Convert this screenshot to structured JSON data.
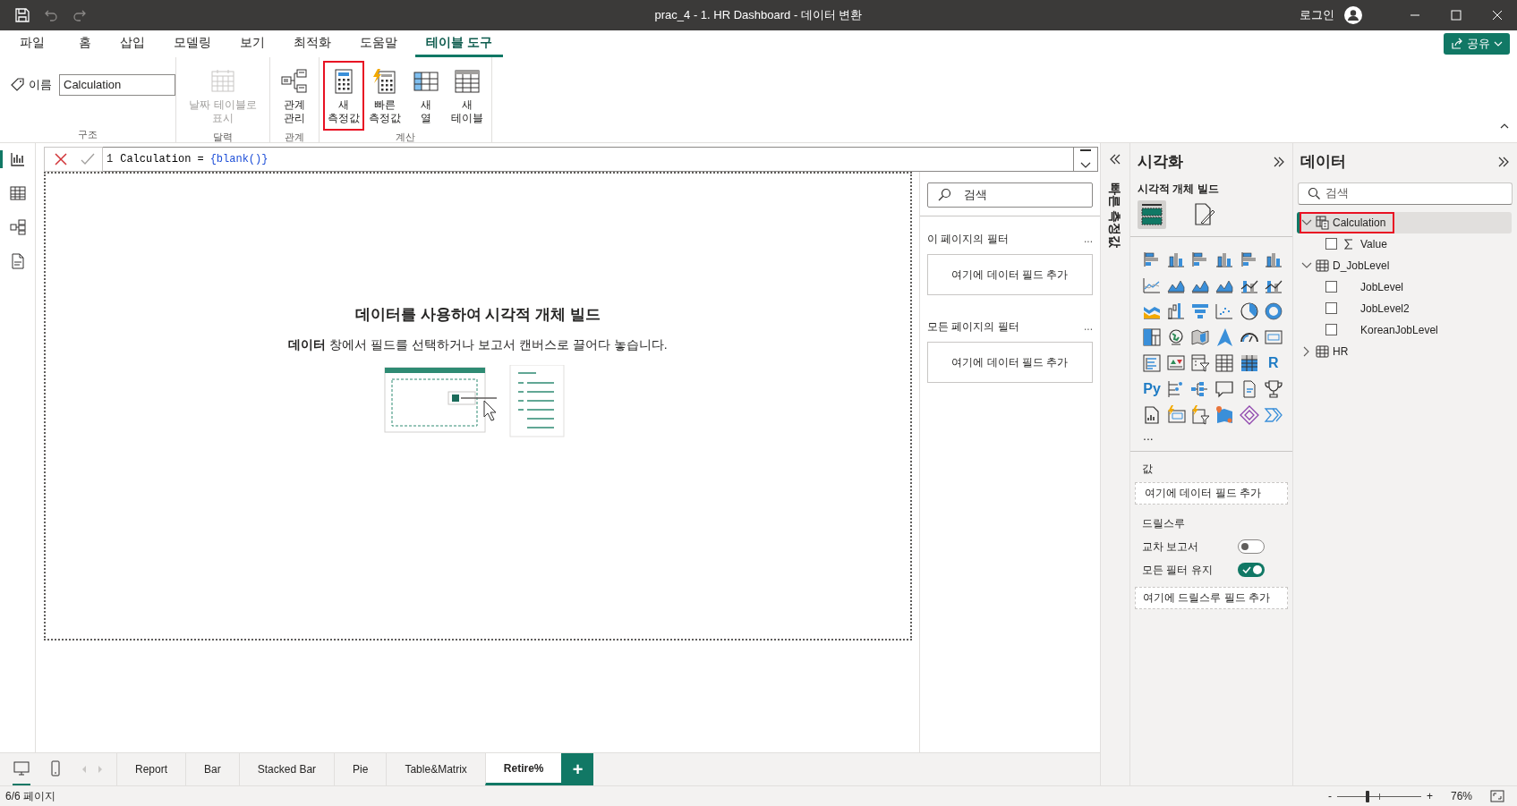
{
  "window": {
    "title": "prac_4 - 1. HR Dashboard - 데이터 변환",
    "account": "로그인"
  },
  "ribbon_tabs": [
    {
      "label": "파일",
      "selected": false
    },
    {
      "label": "홈",
      "selected": false
    },
    {
      "label": "삽입",
      "selected": false
    },
    {
      "label": "모델링",
      "selected": false
    },
    {
      "label": "보기",
      "selected": false
    },
    {
      "label": "최적화",
      "selected": false
    },
    {
      "label": "도움말",
      "selected": false
    },
    {
      "label": "테이블 도구",
      "selected": true
    }
  ],
  "share_button": {
    "label": "공유"
  },
  "ribbon": {
    "name_label": "이름",
    "name_value": "Calculation",
    "groups": [
      {
        "label": "구조",
        "kind": "name"
      },
      {
        "label": "달력",
        "kind": "buttons",
        "buttons": [
          {
            "label": "날짜 테이블로 표시",
            "kind": "calendar",
            "disabled": true,
            "highlighted": false
          }
        ]
      },
      {
        "label": "관계",
        "kind": "buttons",
        "buttons": [
          {
            "label": "관계 관리",
            "kind": "relationship",
            "disabled": false,
            "highlighted": false
          }
        ]
      },
      {
        "label": "계산",
        "kind": "buttons",
        "buttons": [
          {
            "label": "새 측정값",
            "kind": "measure",
            "disabled": false,
            "highlighted": true
          },
          {
            "label": "빠른 측정값",
            "kind": "quick-measure",
            "disabled": false,
            "highlighted": false
          },
          {
            "label": "새 열",
            "kind": "column",
            "disabled": false,
            "highlighted": false
          },
          {
            "label": "새 테이블",
            "kind": "table",
            "disabled": false,
            "highlighted": false
          }
        ]
      }
    ]
  },
  "formula": {
    "line_number": "1",
    "tokens": [
      {
        "text": "Calculation",
        "kind": "name"
      },
      {
        "text": "=",
        "kind": "operator"
      },
      {
        "text": "{blank()}",
        "kind": "function"
      }
    ]
  },
  "canvas": {
    "heading": "데이터를 사용하여 시각적 개체 빌드",
    "hint": "**데이터** 창에서 필드를 선택하거나 보고서 캔버스로 끌어다 놓습니다."
  },
  "filters": {
    "search_placeholder": "검색",
    "sections": [
      {
        "title": "이 페이지의 필터",
        "more": "...",
        "drop_zone": "여기에 데이터 필드 추가"
      },
      {
        "title": "모든 페이지의 필터",
        "more": "...",
        "drop_zone": "여기에 데이터 필드 추가"
      }
    ]
  },
  "quick_measures": {
    "title": "빠른 측정값"
  },
  "visualizations": {
    "title": "시각화",
    "subtitle": "시각적 개체 빌드",
    "build_tabs": [
      {
        "kind": "build",
        "selected": true
      },
      {
        "kind": "format",
        "selected": false
      }
    ],
    "letter_icons": [
      "R",
      "Py"
    ],
    "more": "...",
    "values": {
      "title": "값",
      "drop_zone": "여기에 데이터 필드 추가"
    },
    "drillthrough": {
      "title": "드릴스루",
      "toggles": [
        {
          "label": "교차 보고서",
          "on": false
        },
        {
          "label": "모든 필터 유지",
          "on": true
        }
      ],
      "drop_zone": "여기에 드릴스루 필드 추가"
    }
  },
  "data": {
    "title": "데이터",
    "search_placeholder": "검색",
    "tree": [
      {
        "label": "Calculation",
        "kind": "calculation-table",
        "expanded": true,
        "selected": true,
        "highlighted": true,
        "children": [
          {
            "label": "Value",
            "kind": "measure",
            "checked": false
          }
        ]
      },
      {
        "label": "D_JobLevel",
        "kind": "table",
        "expanded": true,
        "selected": false,
        "highlighted": false,
        "children": [
          {
            "label": "JobLevel",
            "kind": "column",
            "checked": false
          },
          {
            "label": "JobLevel2",
            "kind": "column",
            "checked": false
          },
          {
            "label": "KoreanJobLevel",
            "kind": "column",
            "checked": false
          }
        ]
      },
      {
        "label": "HR",
        "kind": "table",
        "expanded": false,
        "selected": false,
        "highlighted": false
      }
    ]
  },
  "pages": {
    "view_modes": [
      {
        "kind": "desktop",
        "selected": true
      },
      {
        "kind": "mobile",
        "selected": false
      }
    ],
    "tabs": [
      {
        "label": "Report",
        "selected": false
      },
      {
        "label": "Bar",
        "selected": false
      },
      {
        "label": "Stacked Bar",
        "selected": false
      },
      {
        "label": "Pie",
        "selected": false
      },
      {
        "label": "Table&Matrix",
        "selected": false
      },
      {
        "label": "Retire%",
        "selected": true
      }
    ],
    "add": "+"
  },
  "status_bar": {
    "page": "6/6 페이지",
    "zoom_out": "-",
    "zoom_in": "+",
    "zoom": {
      "level": 0.36
    },
    "zoom_reading": "76%"
  }
}
